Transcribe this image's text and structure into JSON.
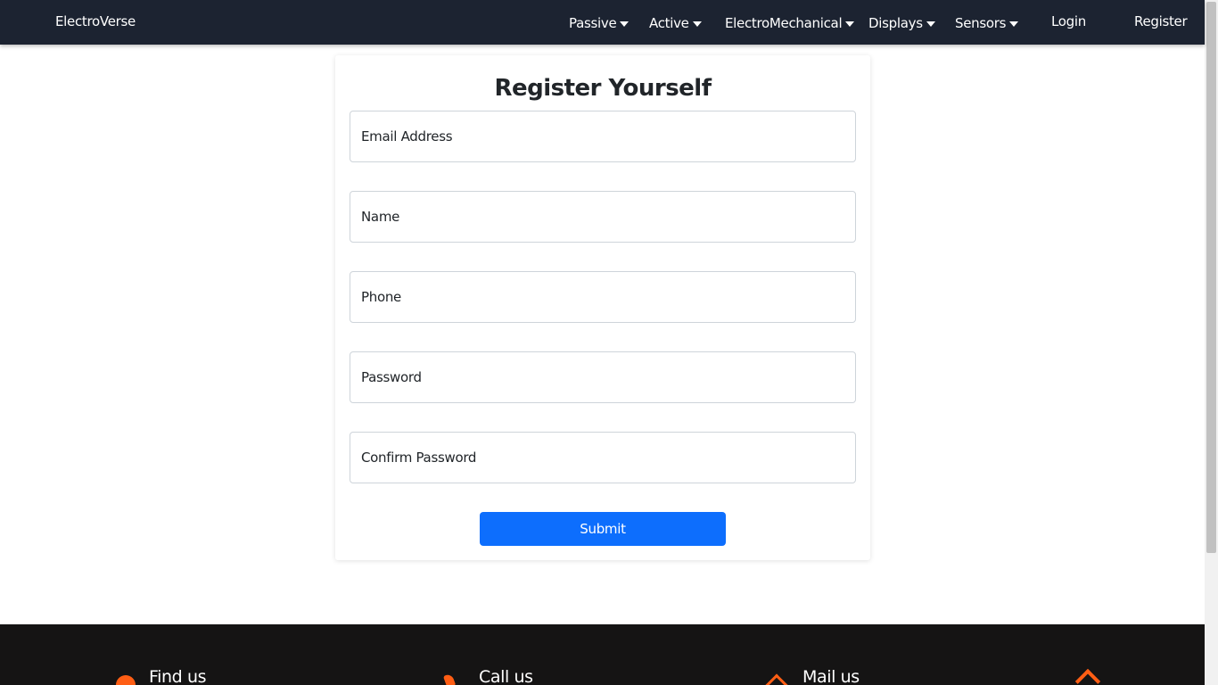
{
  "navbar": {
    "brand": "ElectroVerse",
    "menus": [
      {
        "label": "Passive"
      },
      {
        "label": "Active"
      },
      {
        "label": "ElectroMechanical"
      },
      {
        "label": "Displays"
      },
      {
        "label": "Sensors"
      }
    ],
    "login": "Login",
    "register": "Register"
  },
  "form": {
    "title": "Register Yourself",
    "fields": [
      {
        "label": "Email Address"
      },
      {
        "label": "Name"
      },
      {
        "label": "Phone"
      },
      {
        "label": "Password"
      },
      {
        "label": "Confirm Password"
      }
    ],
    "submit": "Submit"
  },
  "footer": {
    "find_us": "Find us",
    "call_us": "Call us",
    "mail_us": "Mail us",
    "accent_color": "#ff5e14"
  },
  "colors": {
    "navbar_bg": "#1c2331",
    "primary_button": "#0d6efd",
    "footer_bg": "#151414"
  }
}
